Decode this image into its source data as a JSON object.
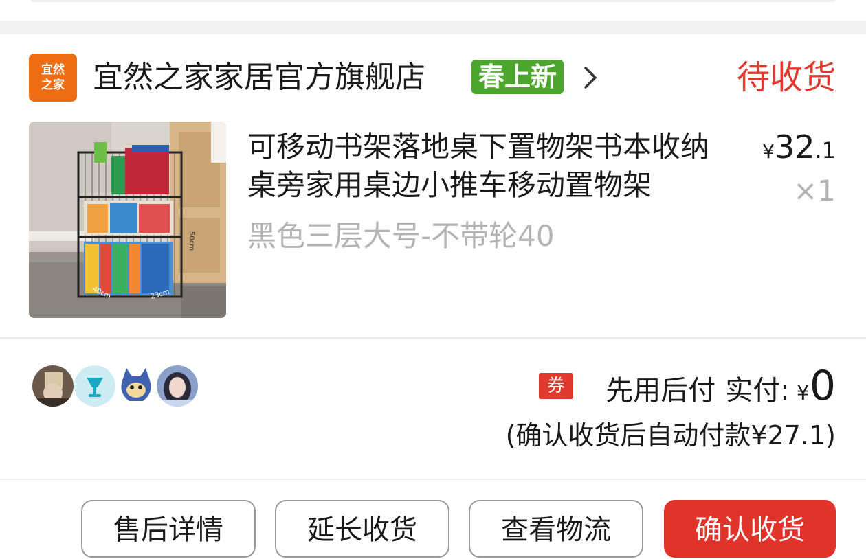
{
  "shop": {
    "logo_text": "宜然之家",
    "name": "宜然之家家居官方旗舰店",
    "badge": "春上新",
    "status": "待收货"
  },
  "product": {
    "title": "可移动书架落地桌下置物架书本收纳桌旁家用桌边小推车移动置物架",
    "spec": "黑色三层大号-不带轮40",
    "price_symbol": "¥",
    "price_int": "32",
    "price_dec": ".1",
    "quantity": "×1",
    "image_labels": {
      "height": "50cm",
      "width": "40cm",
      "depth": "23cm"
    }
  },
  "payment": {
    "coupon_label": "券",
    "pay_later": "先用后付",
    "paid_label": "实付:",
    "paid_symbol": "¥",
    "paid_value": "0",
    "auto_pay_note": "(确认收货后自动付款¥27.1)"
  },
  "buttons": {
    "after_sales": "售后详情",
    "extend": "延长收货",
    "logistics": "查看物流",
    "confirm": "确认收货"
  },
  "colors": {
    "status_red": "#e03a2f",
    "badge_green": "#4ca62e",
    "logo_orange": "#ee6d12",
    "primary_button": "#e0332a"
  }
}
